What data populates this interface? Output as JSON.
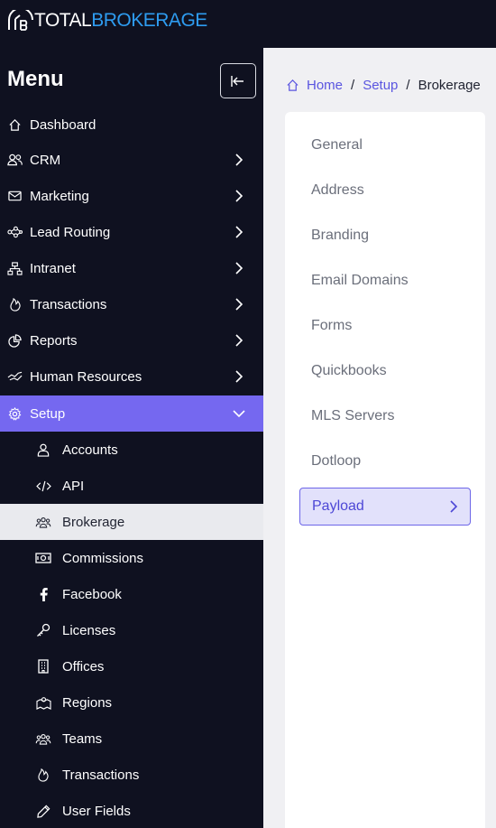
{
  "brand": {
    "logo_text_a": "TOTAL",
    "logo_text_b": "BROKERAGE",
    "accent": "#7568f0",
    "logo_blue": "#2e9cf0"
  },
  "sidebar": {
    "title": "Menu",
    "items": [
      {
        "label": "Dashboard",
        "icon": "home-icon",
        "expandable": false
      },
      {
        "label": "CRM",
        "icon": "users-icon",
        "expandable": true
      },
      {
        "label": "Marketing",
        "icon": "mail-icon",
        "expandable": true
      },
      {
        "label": "Lead Routing",
        "icon": "network-icon",
        "expandable": true
      },
      {
        "label": "Intranet",
        "icon": "sitemap-icon",
        "expandable": true
      },
      {
        "label": "Transactions",
        "icon": "flame-icon",
        "expandable": true
      },
      {
        "label": "Reports",
        "icon": "pie-chart-icon",
        "expandable": true
      },
      {
        "label": "Human Resources",
        "icon": "handshake-icon",
        "expandable": true
      },
      {
        "label": "Setup",
        "icon": "gear-icon",
        "expandable": true,
        "expanded": true
      }
    ],
    "setup_children": [
      {
        "label": "Accounts",
        "icon": "user-icon"
      },
      {
        "label": "API",
        "icon": "code-icon"
      },
      {
        "label": "Brokerage",
        "icon": "group-icon",
        "selected": true
      },
      {
        "label": "Commissions",
        "icon": "money-icon"
      },
      {
        "label": "Facebook",
        "icon": "facebook-icon"
      },
      {
        "label": "Licenses",
        "icon": "key-icon"
      },
      {
        "label": "Offices",
        "icon": "building-icon"
      },
      {
        "label": "Regions",
        "icon": "map-icon"
      },
      {
        "label": "Teams",
        "icon": "group-icon"
      },
      {
        "label": "Transactions",
        "icon": "flame-icon"
      },
      {
        "label": "User Fields",
        "icon": "pen-icon"
      }
    ]
  },
  "breadcrumb": {
    "home": "Home",
    "setup": "Setup",
    "current": "Brokerage",
    "separator": "/"
  },
  "settings_menu": {
    "items": [
      "General",
      "Address",
      "Branding",
      "Email Domains",
      "Forms",
      "Quickbooks",
      "MLS Servers",
      "Dotloop",
      "Payload"
    ],
    "active": "Payload"
  }
}
